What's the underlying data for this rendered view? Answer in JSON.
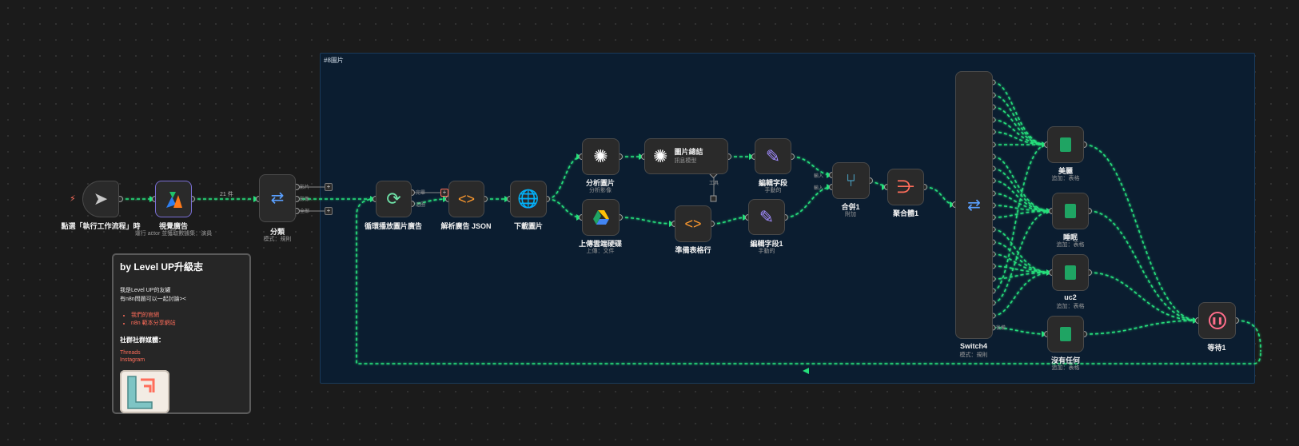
{
  "frame": {
    "label": "#8圖片"
  },
  "nodes": {
    "trigger": {
      "label": "點選「執行工作流程」時",
      "sub": "",
      "icon": "cursor-icon"
    },
    "shijian": {
      "label": "視覺廣告",
      "sub": "運行 actor 並獲取數據集：演員",
      "icon": "apify-icon"
    },
    "fenlei": {
      "label": "分類",
      "sub": "模式：規則",
      "icon": "switch-icon"
    },
    "loop": {
      "label": "循環播放圖片廣告",
      "sub": "",
      "icon": "loop-icon"
    },
    "parse": {
      "label": "解析廣告 JSON",
      "sub": "",
      "icon": "code-icon"
    },
    "download": {
      "label": "下載圖片",
      "sub": "",
      "icon": "globe-icon"
    },
    "analyze": {
      "label": "分析圖片",
      "sub": "分析影像",
      "icon": "openai-icon"
    },
    "summary": {
      "label": "圖片總結",
      "sub": "訊息模型",
      "icon": "openai-icon"
    },
    "edit1": {
      "label": "編輯字段",
      "sub": "手動的",
      "icon": "pencil-icon"
    },
    "upload": {
      "label": "上傳雲端硬碟",
      "sub": "上傳：文件",
      "icon": "gdrive-icon"
    },
    "prepare": {
      "label": "準備表格行",
      "sub": "",
      "icon": "code-icon"
    },
    "edit2": {
      "label": "編輯字段1",
      "sub": "手動的",
      "icon": "pencil-icon"
    },
    "merge": {
      "label": "合併1",
      "sub": "附加",
      "icon": "merge-icon"
    },
    "aggregate": {
      "label": "聚合體1",
      "sub": "",
      "icon": "aggregate-icon"
    },
    "switch4": {
      "label": "Switch4",
      "sub": "模式：規則",
      "icon": "switch-icon"
    },
    "sheet1": {
      "label": "美麗",
      "sub": "追加：表格",
      "icon": "sheets-icon"
    },
    "sheet2": {
      "label": "睡眠",
      "sub": "追加：表格",
      "icon": "sheets-icon"
    },
    "sheet3": {
      "label": "uc2",
      "sub": "追加：表格",
      "icon": "sheets-icon"
    },
    "sheet4": {
      "label": "沒有任何",
      "sub": "追加：表格",
      "icon": "sheets-icon"
    },
    "wait": {
      "label": "等待1",
      "sub": "",
      "icon": "pause-icon"
    }
  },
  "port_labels": {
    "fenlei_out": [
      "影片",
      "影像",
      "全部"
    ],
    "loop_out": [
      "完畢",
      "迴圈"
    ],
    "merge_in": [
      "輸入",
      "輸入"
    ],
    "summary_tool": "工具",
    "switch4_extra": "後備"
  },
  "connections": {
    "count_label": "21 件"
  },
  "card": {
    "title": "by Level UP升級志",
    "line1": "我是Level UP的友罐",
    "line2": "有n8n問題可以一起討論><",
    "links": [
      "我們的官網",
      "n8n 範本分享網站"
    ],
    "social_heading": "社群社群媒體：",
    "social_links": [
      "Threads",
      "Instagram"
    ]
  },
  "colors": {
    "wire": "#25e07b",
    "canvas": "#1b1b1b",
    "frame": "#0b1d30",
    "accent": "#ff6d5a"
  }
}
